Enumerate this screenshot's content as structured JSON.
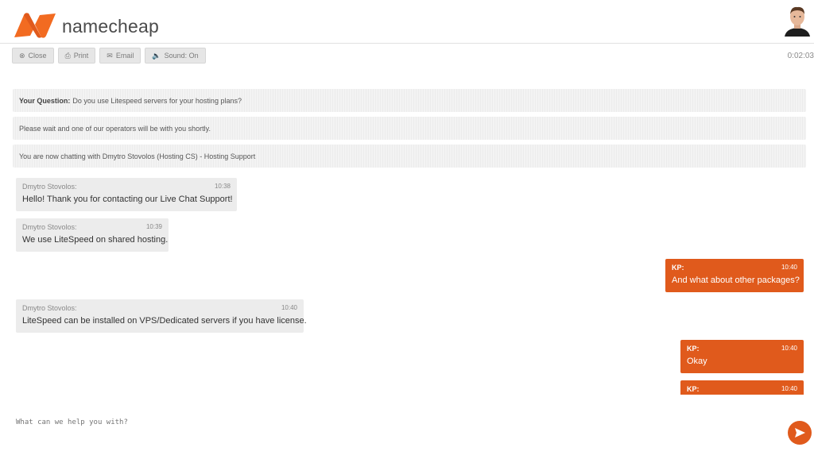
{
  "brand": {
    "name": "namecheap",
    "color": "#e05a1c"
  },
  "toolbar": {
    "close_label": "Close",
    "print_label": "Print",
    "email_label": "Email",
    "sound_label": "Sound: On"
  },
  "timer": "0:02:03",
  "system_messages": [
    {
      "bold": "Your Question:",
      "text": "Do you use Litespeed servers for your hosting plans?"
    },
    {
      "text": "Please wait and one of our operators will be with you shortly."
    },
    {
      "text": "You are now chatting with Dmytro Stovolos (Hosting CS) - Hosting Support"
    }
  ],
  "messages": [
    {
      "from": "operator",
      "name": "Dmytro Stovolos:",
      "time": "10:38",
      "text": "Hello! Thank you for contacting our Live Chat Support!"
    },
    {
      "from": "operator",
      "name": "Dmytro Stovolos:",
      "time": "10:39",
      "text": "We use LiteSpeed on shared hosting."
    },
    {
      "from": "user",
      "name": "KP:",
      "time": "10:40",
      "text": "And what about other packages?"
    },
    {
      "from": "operator",
      "name": "Dmytro Stovolos:",
      "time": "10:40",
      "text": "LiteSpeed can be installed on VPS/Dedicated servers if you have license."
    },
    {
      "from": "user",
      "name": "KP:",
      "time": "10:40",
      "text": "Okay"
    },
    {
      "from": "user",
      "name": "KP:",
      "time": "10:40",
      "text": ""
    }
  ],
  "composer": {
    "placeholder": "What can we help you with?"
  }
}
